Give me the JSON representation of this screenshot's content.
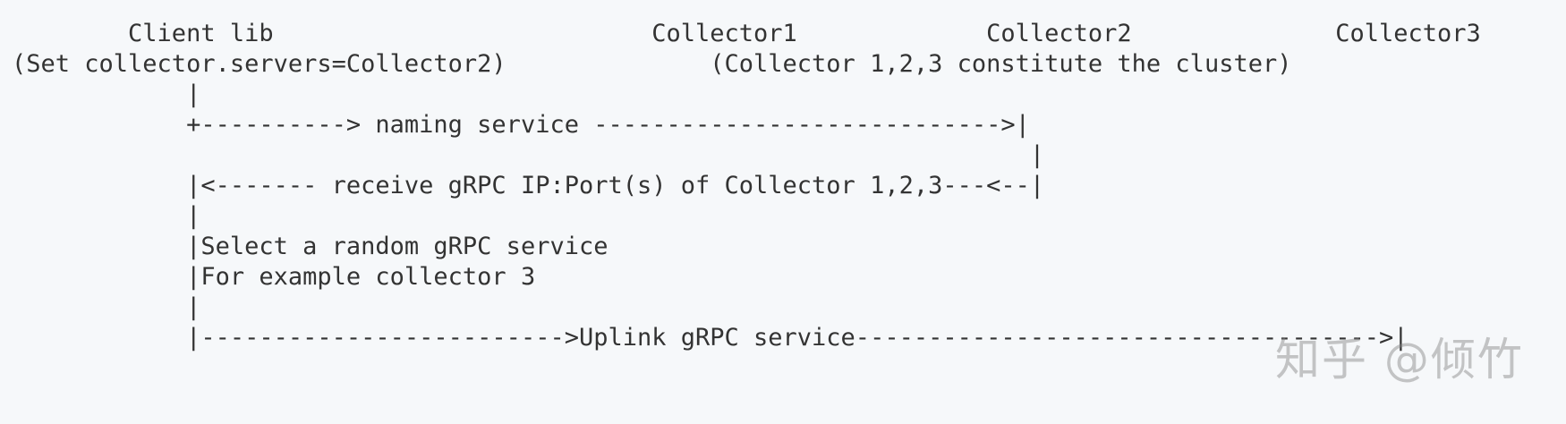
{
  "diagram": {
    "lines": [
      "        Client lib                          Collector1             Collector2              Collector3",
      "(Set collector.servers=Collector2)              (Collector 1,2,3 constitute the cluster)",
      "            |",
      "            +----------> naming service ---------------------------->|",
      "                                                                      |",
      "            |<------- receive gRPC IP:Port(s) of Collector 1,2,3---<--|",
      "            |",
      "            |Select a random gRPC service",
      "            |For example collector 3",
      "            |",
      "            |------------------------->Uplink gRPC service------------------------------------>|"
    ],
    "watermark": "知乎 @倾竹"
  }
}
